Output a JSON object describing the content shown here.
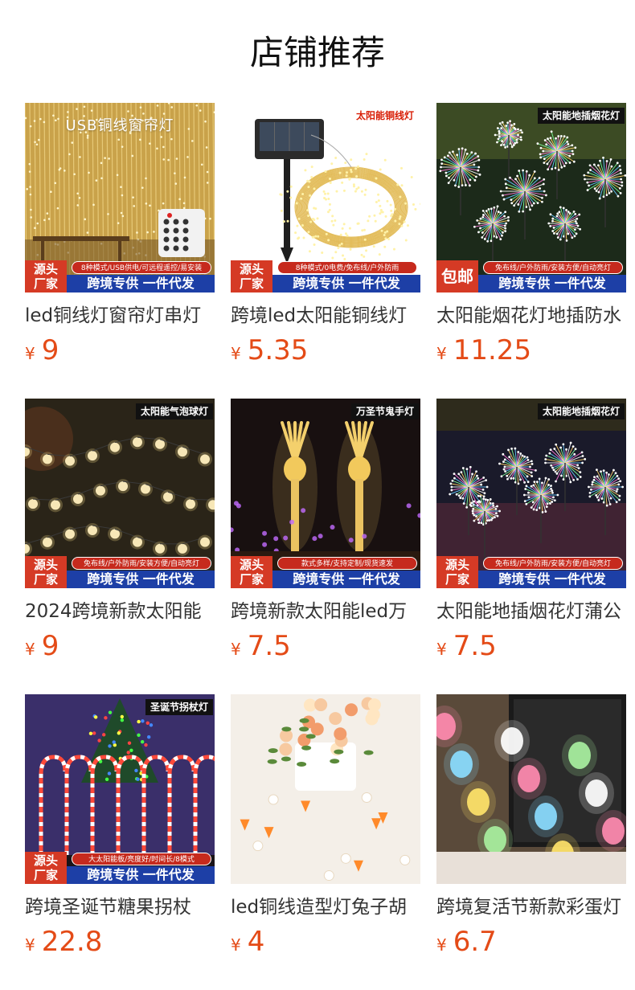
{
  "header": {
    "title": "店铺推荐"
  },
  "colors": {
    "price": "#e44b17",
    "badge_red": "#d53a25",
    "badge_blue": "#1d3fa6"
  },
  "banner_main": "跨境专供 一件代发",
  "products": [
    {
      "name": "led铜线灯窗帘灯串灯",
      "currency": "¥",
      "price": "9",
      "top_text": "USB铜线窗帘灯",
      "corner_tag": "",
      "badge": "源头\n厂家",
      "features": "8种模式/USB供电/可远程遥控/易安装",
      "icon": "curtain-light-photo"
    },
    {
      "name": "跨境led太阳能铜线灯",
      "currency": "¥",
      "price": "5.35",
      "top_text": "",
      "corner_tag": "太阳能铜线灯",
      "badge": "源头\n厂家",
      "features": "8种模式/0电费/免布线/户外防雨",
      "icon": "solar-copper-light-photo"
    },
    {
      "name": "太阳能烟花灯地插防水",
      "currency": "¥",
      "price": "11.25",
      "top_text": "",
      "corner_tag": "太阳能地插烟花灯",
      "badge": "包邮",
      "features": "免布线/户外防雨/安装方便/自动亮灯",
      "icon": "firework-light-photo"
    },
    {
      "name": "2024跨境新款太阳能",
      "currency": "¥",
      "price": "9",
      "top_text": "",
      "corner_tag": "太阳能气泡球灯",
      "badge": "源头\n厂家",
      "features": "免布线/户外防雨/安装方便/自动亮灯",
      "icon": "bubble-ball-light-photo"
    },
    {
      "name": "跨境新款太阳能led万",
      "currency": "¥",
      "price": "7.5",
      "top_text": "",
      "corner_tag": "万圣节鬼手灯",
      "badge": "源头\n厂家",
      "features": "款式多样/支持定制/现货速发",
      "icon": "ghost-hand-light-photo"
    },
    {
      "name": "太阳能地插烟花灯蒲公",
      "currency": "¥",
      "price": "7.5",
      "top_text": "",
      "corner_tag": "太阳能地插烟花灯",
      "badge": "源头\n厂家",
      "features": "免布线/户外防雨/安装方便/自动亮灯",
      "icon": "dandelion-light-photo"
    },
    {
      "name": "跨境圣诞节糖果拐杖",
      "currency": "¥",
      "price": "22.8",
      "top_text": "",
      "corner_tag": "圣诞节拐杖灯",
      "badge": "源头\n厂家",
      "features": "大太阳能板/亮度好/时间长/8模式",
      "icon": "candy-cane-light-photo"
    },
    {
      "name": "led铜线造型灯兔子胡",
      "currency": "¥",
      "price": "4",
      "top_text": "",
      "corner_tag": "",
      "badge": "",
      "features": "",
      "icon": "bunny-carrot-light-photo"
    },
    {
      "name": "跨境复活节新款彩蛋灯",
      "currency": "¥",
      "price": "6.7",
      "top_text": "",
      "corner_tag": "",
      "badge": "",
      "features": "",
      "icon": "easter-egg-light-photo"
    }
  ]
}
